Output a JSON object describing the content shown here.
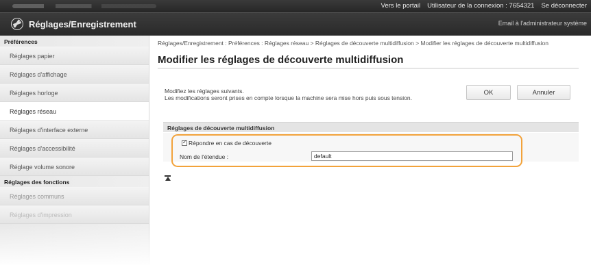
{
  "topbar": {
    "portal_link": "Vers le portail",
    "user_label": "Utilisateur de la connexion :",
    "user_id": "7654321",
    "logout_link": "Se déconnecter"
  },
  "header": {
    "title": "Réglages/Enregistrement",
    "admin_mail": "Email à l'administrateur système"
  },
  "sidebar": {
    "section_preferences": "Préférences",
    "items": [
      {
        "label": "Réglages papier"
      },
      {
        "label": "Réglages d'affichage"
      },
      {
        "label": "Réglages horloge"
      },
      {
        "label": "Réglages réseau"
      },
      {
        "label": "Réglages d'interface externe"
      },
      {
        "label": "Réglages d'accessibilité"
      },
      {
        "label": "Réglage volume sonore"
      }
    ],
    "section_functions": "Réglages des fonctions",
    "function_items": [
      {
        "label": "Réglages communs"
      },
      {
        "label": "Réglages d'impression"
      }
    ]
  },
  "main": {
    "breadcrumb": "Réglages/Enregistrement : Préférences : Réglages réseau > Réglages de découverte multidiffusion > Modifier les réglages de découverte multidiffusion",
    "page_title": "Modifier les réglages de découverte multidiffusion",
    "instruction_line1": "Modifiez les réglages suivants.",
    "instruction_line2": "Les modifications seront prises en compte lorsque la machine sera mise hors puis sous tension.",
    "ok_label": "OK",
    "cancel_label": "Annuler",
    "panel_title": "Réglages de découverte multidiffusion",
    "respond_checkbox_label": "Répondre en cas de découverte",
    "respond_checked": true,
    "scope_label": "Nom de l'étendue :",
    "scope_value": "default"
  },
  "colors": {
    "highlight": "#f2a23a",
    "header_bg": "#2e2e2e"
  }
}
